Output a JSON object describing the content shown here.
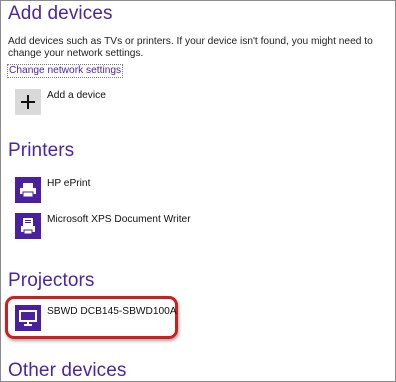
{
  "add_devices": {
    "heading": "Add devices",
    "description": "Add devices such as TVs or printers. If your device isn't found, you might need to change your network settings.",
    "change_network_link": "Change network settings",
    "add_device_label": "Add a device",
    "add_icon": "plus-icon"
  },
  "printers": {
    "heading": "Printers",
    "items": [
      {
        "label": "HP ePrint",
        "icon": "printer-icon"
      },
      {
        "label": "Microsoft XPS Document Writer",
        "icon": "document-writer-icon"
      }
    ]
  },
  "projectors": {
    "heading": "Projectors",
    "items": [
      {
        "label": "SBWD DCB145-SBWD100A",
        "icon": "monitor-icon"
      }
    ]
  },
  "other_devices": {
    "heading": "Other devices"
  },
  "colors": {
    "accent": "#4a25a8",
    "tile_purple": "#4a1fa0",
    "tile_gray": "#d9d9d9",
    "highlight": "#cc1f1f"
  }
}
